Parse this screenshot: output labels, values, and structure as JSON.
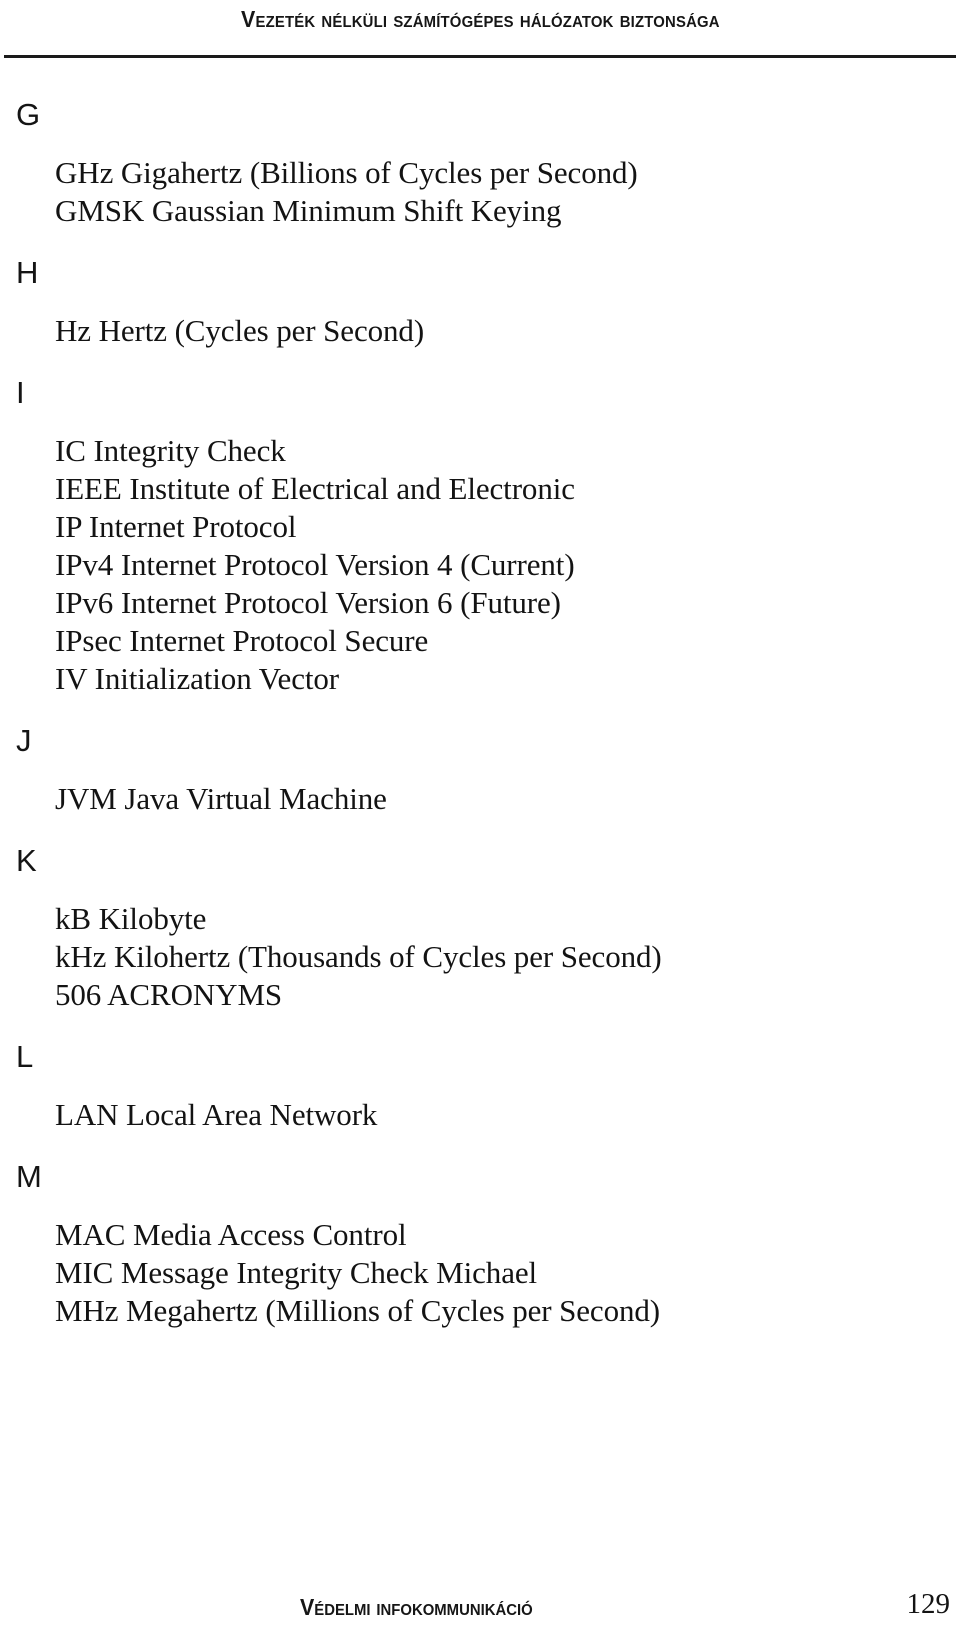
{
  "header": {
    "title": "Vezeték nélküli számítógépes hálózatok biztonsága"
  },
  "footer": {
    "title": "Védelmi infokommunikáció",
    "page_number": "129"
  },
  "glossary": {
    "sections": [
      {
        "letter": "G",
        "entries": [
          "GHz Gigahertz (Billions of Cycles per Second)",
          "GMSK Gaussian Minimum Shift Keying"
        ]
      },
      {
        "letter": "H",
        "entries": [
          "Hz Hertz (Cycles per Second)"
        ]
      },
      {
        "letter": "I",
        "entries": [
          "IC Integrity Check",
          "IEEE Institute of Electrical and Electronic",
          "IP Internet Protocol",
          "IPv4 Internet Protocol Version 4 (Current)",
          "IPv6 Internet Protocol Version 6 (Future)",
          "IPsec Internet Protocol Secure",
          "IV Initialization Vector"
        ]
      },
      {
        "letter": "J",
        "entries": [
          "JVM Java Virtual Machine"
        ]
      },
      {
        "letter": "K",
        "entries": [
          "kB Kilobyte",
          "kHz Kilohertz (Thousands of Cycles per Second)",
          "506 ACRONYMS"
        ]
      },
      {
        "letter": "L",
        "entries": [
          "LAN Local Area Network"
        ]
      },
      {
        "letter": "M",
        "entries": [
          "MAC Media Access Control",
          "MIC Message Integrity Check Michael",
          "MHz Megahertz (Millions of Cycles per Second)"
        ]
      }
    ]
  }
}
